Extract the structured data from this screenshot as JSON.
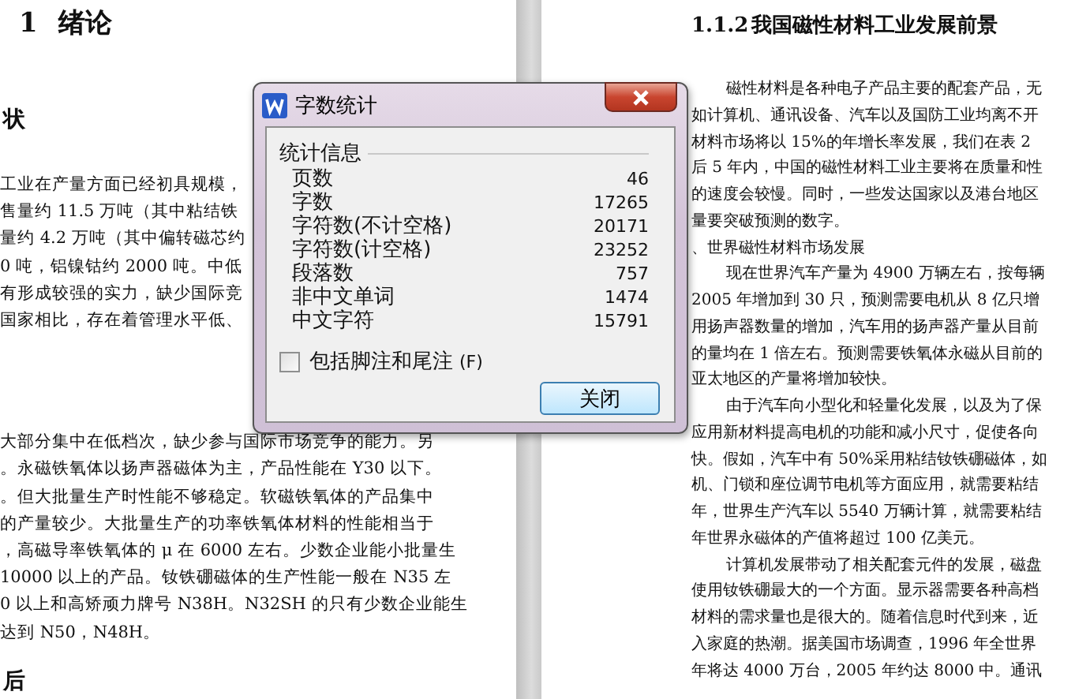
{
  "left_page": {
    "heading_number": "1",
    "heading": "绪论",
    "subheading": "状",
    "lines_top": [
      "工业在产量方面已经初具规模，",
      "售量约 11.5 万吨（其中粘结铁",
      "量约 4.2 万吨（其中偏转磁芯约",
      "0 吨，铝镍钴约 2000 吨。中低",
      "有形成较强的实力，缺少国际竞",
      "国家相比，存在着管理水平低、"
    ],
    "lines_bottom": [
      "大部分集中在低档次，缺少参与国际市场竞争的能力。另",
      "。永磁铁氧体以扬声器磁体为主，产品性能在 Y30 以下。",
      "。但大批量生产时性能不够稳定。软磁铁氧体的产品集中",
      "的产量较少。大批量生产的功率铁氧体材料的性能相当于",
      "，高磁导率铁氧体的 μ 在 6000 左右。少数企业能小批量生",
      "10000 以上的产品。钕铁硼磁体的生产性能一般在 N35 左",
      "0 以上和高矫顽力牌号 N38H。N32SH 的只有少数企业能生",
      "达到 N50，N48H。"
    ],
    "next_heading": "后"
  },
  "right_page": {
    "heading_number": "1.1.2",
    "heading": "我国磁性材料工业发展前景",
    "lines": [
      {
        "text": "磁性材料是各种电子产品主要的配套产品，无",
        "indent": true
      },
      {
        "text": "如计算机、通讯设备、汽车以及国防工业均离不开",
        "indent": false
      },
      {
        "text": "材料市场将以 15%的年增长率发展，我们在表 2",
        "indent": false
      },
      {
        "text": "后 5 年内，中国的磁性材料工业主要将在质量和性",
        "indent": false
      },
      {
        "text": "的速度会较慢。同时，一些发达国家以及港台地区",
        "indent": false
      },
      {
        "text": "量要突破预测的数字。",
        "indent": false
      },
      {
        "text": "、世界磁性材料市场发展",
        "indent": false
      },
      {
        "text": "现在世界汽车产量为 4900 万辆左右，按每辆",
        "indent": true
      },
      {
        "text": "2005 年增加到 30 只，预测需要电机从 8 亿只增",
        "indent": false
      },
      {
        "text": "用扬声器数量的增加，汽车用的扬声器产量从目前",
        "indent": false
      },
      {
        "text": "的量均在 1 倍左右。预测需要铁氧体永磁从目前的",
        "indent": false
      },
      {
        "text": "亚太地区的产量将增加较快。",
        "indent": false
      },
      {
        "text": "由于汽车向小型化和轻量化发展，以及为了保",
        "indent": true
      },
      {
        "text": "应用新材料提高电机的功能和减小尺寸，促使各向",
        "indent": false
      },
      {
        "text": "快。假如，汽车中有 50%采用粘结钕铁硼磁体，如",
        "indent": false
      },
      {
        "text": "机、门锁和座位调节电机等方面应用，就需要粘结",
        "indent": false
      },
      {
        "text": "年，世界生产汽车以 5540 万辆计算，就需要粘结",
        "indent": false
      },
      {
        "text": "年世界永磁体的产值将超过 100 亿美元。",
        "indent": false
      },
      {
        "text": "计算机发展带动了相关配套元件的发展，磁盘",
        "indent": true
      },
      {
        "text": "使用钕铁硼最大的一个方面。显示器需要各种高档",
        "indent": false
      },
      {
        "text": "材料的需求量也是很大的。随着信息时代到来，近",
        "indent": false
      },
      {
        "text": "入家庭的热潮。据美国市场调查，1996 年全世界",
        "indent": false
      },
      {
        "text": "年将达 4000 万台，2005 年约达 8000 中。通讯",
        "indent": false
      }
    ]
  },
  "dialog": {
    "title": "字数统计",
    "group_label": "统计信息",
    "stats": [
      {
        "label": "页数",
        "value": "46"
      },
      {
        "label": "字数",
        "value": "17265"
      },
      {
        "label": "字符数(不计空格)",
        "value": "20171"
      },
      {
        "label": "字符数(计空格)",
        "value": "23252"
      },
      {
        "label": "段落数",
        "value": "757"
      },
      {
        "label": "非中文单词",
        "value": "1474"
      },
      {
        "label": "中文字符",
        "value": "15791"
      }
    ],
    "checkbox": {
      "label": "包括脚注和尾注",
      "shortcut": "(F)",
      "checked": false
    },
    "button": "关闭"
  }
}
